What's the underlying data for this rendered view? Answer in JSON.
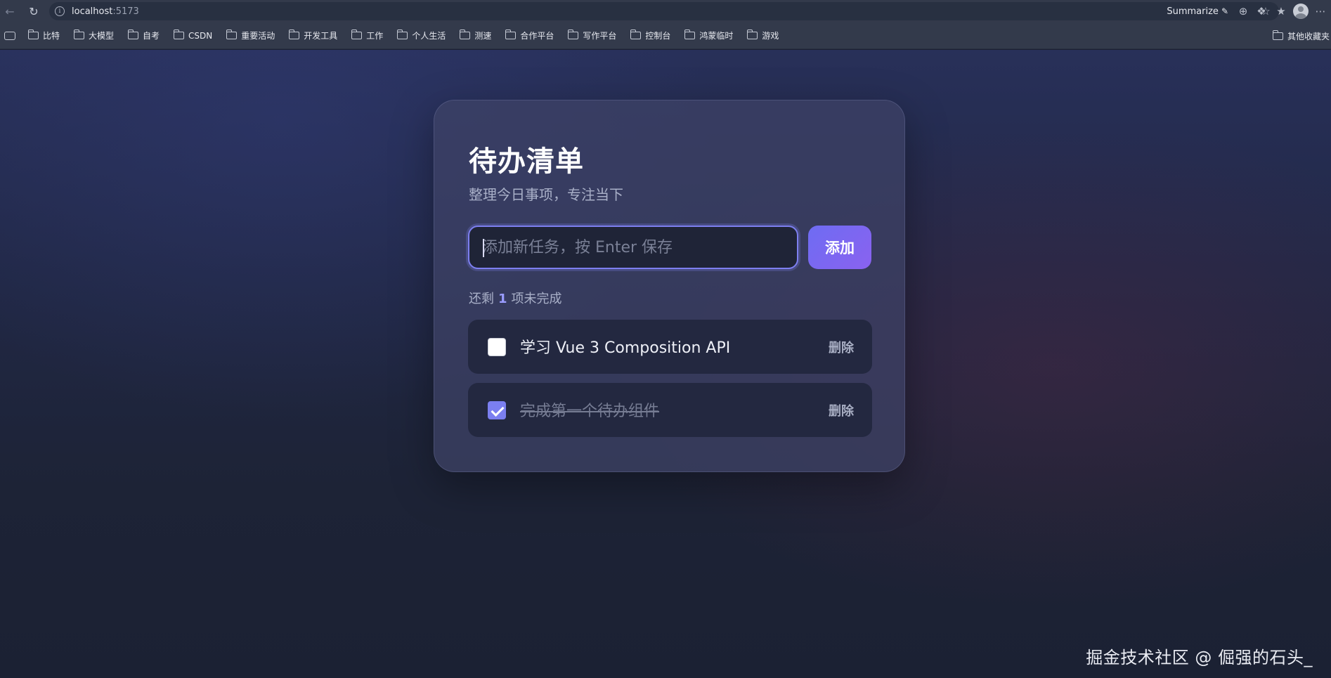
{
  "browser": {
    "url_host": "localhost",
    "url_port": ":5173",
    "summarize_label": "Summarize",
    "bookmarks": [
      "比特",
      "大模型",
      "自考",
      "CSDN",
      "重要活动",
      "开发工具",
      "工作",
      "个人生活",
      "测速",
      "合作平台",
      "写作平台",
      "控制台",
      "鸿蒙临时",
      "游戏"
    ],
    "other_bookmarks": "其他收藏夹"
  },
  "app": {
    "title": "待办清单",
    "subtitle": "整理今日事项，专注当下",
    "input": {
      "value": "",
      "placeholder": "添加新任务，按 Enter 保存"
    },
    "add_label": "添加",
    "remaining": {
      "prefix": "还剩",
      "count": "1",
      "suffix": "项未完成"
    },
    "todos": [
      {
        "text": "学习 Vue 3 Composition API",
        "done": false,
        "delete_label": "删除"
      },
      {
        "text": "完成第一个待办组件",
        "done": true,
        "delete_label": "删除"
      }
    ],
    "accent_color": "#7b7ff0"
  },
  "watermark": "掘金技术社区 @ 倔强的石头_"
}
